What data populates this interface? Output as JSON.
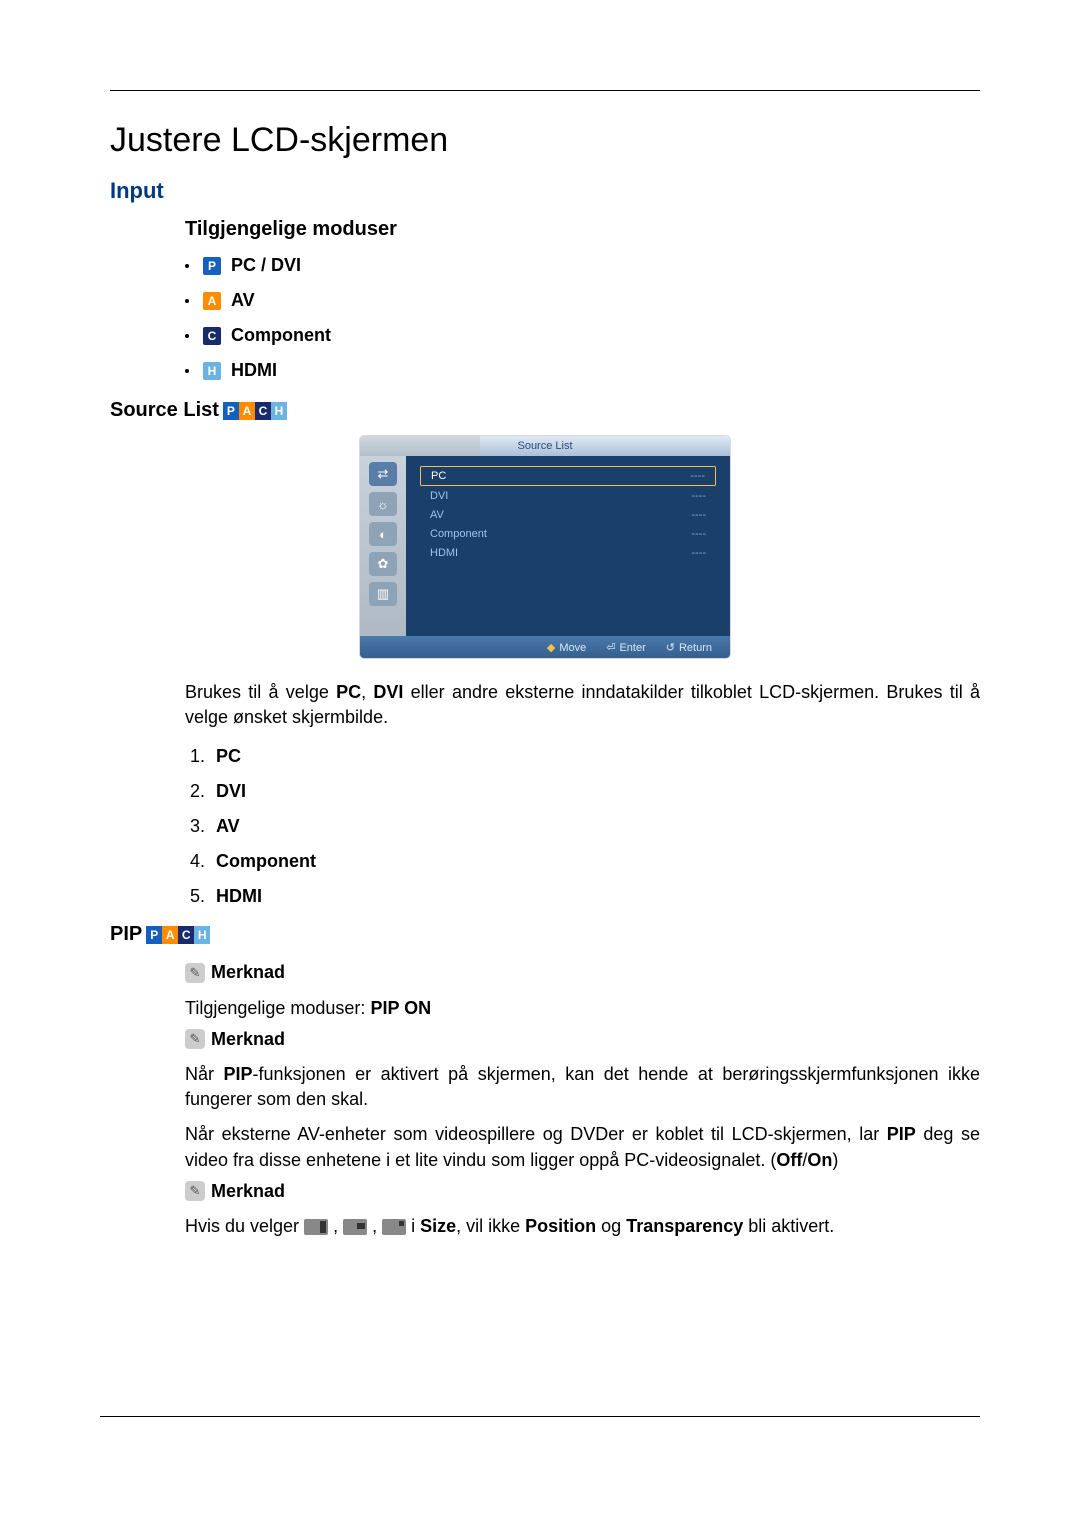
{
  "title": "Justere LCD-skjermen",
  "input": {
    "heading": "Input",
    "modes_heading": "Tilgjengelige moduser",
    "modes": [
      {
        "badge": "P",
        "label": "PC / DVI"
      },
      {
        "badge": "A",
        "label": "AV"
      },
      {
        "badge": "C",
        "label": "Component"
      },
      {
        "badge": "H",
        "label": "HDMI"
      }
    ]
  },
  "source_list": {
    "heading": "Source List",
    "osd": {
      "title": "Source List",
      "items": [
        {
          "name": "PC",
          "value": "----",
          "selected": true
        },
        {
          "name": "DVI",
          "value": "----",
          "selected": false
        },
        {
          "name": "AV",
          "value": "----",
          "selected": false
        },
        {
          "name": "Component",
          "value": "----",
          "selected": false
        },
        {
          "name": "HDMI",
          "value": "----",
          "selected": false
        }
      ],
      "footer": {
        "move": "Move",
        "enter": "Enter",
        "return": "Return"
      }
    },
    "desc_prefix": "Brukes til å velge ",
    "desc_bold1": "PC",
    "desc_sep": ", ",
    "desc_bold2": "DVI",
    "desc_suffix": " eller andre eksterne inndatakilder tilkoblet LCD-skjermen. Brukes til å velge ønsket skjermbilde.",
    "numbered": [
      "PC",
      "DVI",
      "AV",
      "Component",
      "HDMI"
    ]
  },
  "pip": {
    "heading": "PIP",
    "note_label": "Merknad",
    "avail_prefix": "Tilgjengelige moduser: ",
    "avail_value": "PIP ON",
    "warn_prefix": "Når ",
    "warn_bold": "PIP",
    "warn_suffix": "-funksjonen er aktivert på skjermen, kan det hende at berøringsskjermfunksjonen ikke fungerer som den skal.",
    "p2_prefix": "Når eksterne AV-enheter som videospillere og DVDer er koblet til LCD-skjermen, lar ",
    "p2_bold": "PIP",
    "p2_mid": " deg se video fra disse enhetene i et lite vindu som ligger oppå PC-videosignalet. (",
    "p2_off": "Off",
    "p2_slash": "/",
    "p2_on": "On",
    "p2_close": ")",
    "size_prefix": "Hvis du velger ",
    "size_mid": " i ",
    "size_b1": "Size",
    "size_mid2": ", vil ikke ",
    "size_b2": "Position",
    "size_and": " og ",
    "size_b3": "Transparency",
    "size_suffix": " bli aktivert."
  }
}
